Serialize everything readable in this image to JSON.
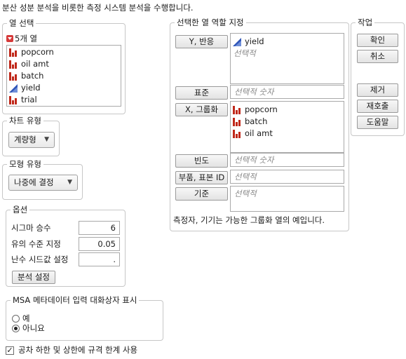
{
  "header": {
    "description": "분산 성분 분석을 비롯한 측정 시스템 분석을 수행합니다."
  },
  "column_select": {
    "title": "열 선택",
    "count_label": "5개 열",
    "columns": [
      {
        "name": "popcorn",
        "icon": "nominal-bar-icon"
      },
      {
        "name": "oil amt",
        "icon": "nominal-bar-icon"
      },
      {
        "name": "batch",
        "icon": "nominal-bar-icon"
      },
      {
        "name": "yield",
        "icon": "continuous-triangle-icon"
      },
      {
        "name": "trial",
        "icon": "nominal-bar-icon"
      }
    ]
  },
  "chart_type": {
    "title": "차트 유형",
    "value": "계량형"
  },
  "model_type": {
    "title": "모형 유형",
    "value": "나중에 결정"
  },
  "options": {
    "title": "옵션",
    "sigma_label": "시그마 승수",
    "sigma_value": "6",
    "alpha_label": "유의 수준 지정",
    "alpha_value": "0.05",
    "seed_label": "난수 시드값 설정",
    "seed_value": ".",
    "analysis_settings": "분석 설정"
  },
  "msa": {
    "title": "MSA 메타데이터 입력 대화상자 표시",
    "yes": "예",
    "no": "아니요",
    "selected": "no"
  },
  "spec_limits": {
    "label": "공차 하한 및 상한에 규격 한계 사용",
    "checked": true
  },
  "roles": {
    "title": "선택한 열 역할 지정",
    "y_button": "Y, 반응",
    "y_items": [
      "yield"
    ],
    "optional": "선택적",
    "standard_button": "표준",
    "optional_numeric": "선택적 숫자",
    "x_button": "X, 그룹화",
    "x_items": [
      "popcorn",
      "batch",
      "oil amt"
    ],
    "freq_button": "빈도",
    "part_button": "부품, 표본 ID",
    "by_button": "기준",
    "note": "측정자, 기기는 가능한 그룹화 열의 예입니다."
  },
  "actions": {
    "title": "작업",
    "ok": "확인",
    "cancel": "취소",
    "remove": "제거",
    "recall": "재호출",
    "help": "도움말"
  }
}
